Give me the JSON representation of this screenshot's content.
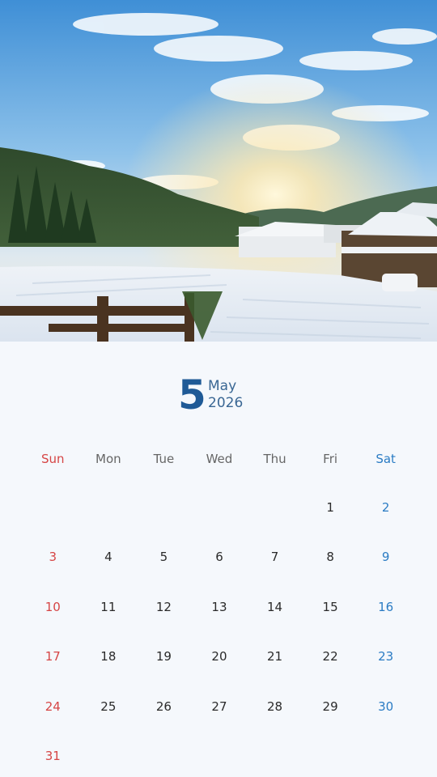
{
  "calendar": {
    "month_number": "5",
    "month_name": "May",
    "year": "2026",
    "weekdays": [
      "Sun",
      "Mon",
      "Tue",
      "Wed",
      "Thu",
      "Fri",
      "Sat"
    ],
    "leading_blanks": 5,
    "days": [
      "1",
      "2",
      "3",
      "4",
      "5",
      "6",
      "7",
      "8",
      "9",
      "10",
      "11",
      "12",
      "13",
      "14",
      "15",
      "16",
      "17",
      "18",
      "19",
      "20",
      "21",
      "22",
      "23",
      "24",
      "25",
      "26",
      "27",
      "28",
      "29",
      "30",
      "31"
    ],
    "colors": {
      "sunday": "#d64545",
      "saturday": "#2b7cc4",
      "weekday": "#2a2a2a",
      "accent": "#1f5a96"
    }
  },
  "photo": {
    "subject": "snowy-village-sunrise-landscape"
  }
}
